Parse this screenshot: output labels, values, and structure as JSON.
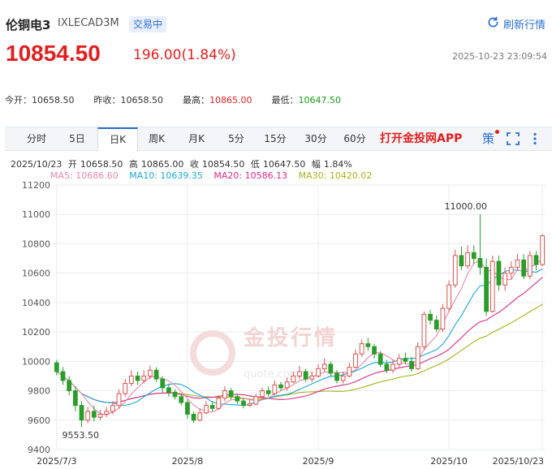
{
  "header": {
    "title": "伦铜电3",
    "code": "IXLECAD3M",
    "status": "交易中",
    "refresh_label": "刷新行情",
    "price": "10854.50",
    "change": "196.00(1.84%)",
    "timestamp": "2025-10-23 23:09:54"
  },
  "stats": [
    {
      "label": "今开：",
      "value": "10658.50",
      "color": "#333333"
    },
    {
      "label": "昨收：",
      "value": "10658.50",
      "color": "#333333"
    },
    {
      "label": "最高：",
      "value": "10865.00",
      "color": "#e02020"
    },
    {
      "label": "最低：",
      "value": "10647.50",
      "color": "#1a9b1a"
    }
  ],
  "toolbar": {
    "tabs": [
      "分时",
      "5日",
      "日K",
      "周K",
      "月K",
      "5分",
      "15分",
      "30分",
      "60分"
    ],
    "active": "日K",
    "promo": "打开金投网APP",
    "strategy_label": "策"
  },
  "ohlc": {
    "date": "2025/10/23",
    "open_label": "开",
    "open": "10658.50",
    "high_label": "高",
    "high": "10865.00",
    "close_label": "收",
    "close": "10854.50",
    "low_label": "低",
    "low": "10647.50",
    "amp_label": "幅",
    "amp": "1.84%"
  },
  "ma_legend": [
    {
      "text": "MA5: 10686.60",
      "color": "#e88aa8"
    },
    {
      "text": "MA10: 10639.35",
      "color": "#1aa7d8"
    },
    {
      "text": "MA20: 10586.13",
      "color": "#d52b8a"
    },
    {
      "text": "MA30: 10420.02",
      "color": "#a3b316"
    }
  ],
  "watermark": {
    "text": "金投行情",
    "sub": "quote.cngold.org"
  },
  "colors": {
    "up": "#d9534f",
    "down": "#2a9d2a",
    "accent": "#2d6fd1"
  },
  "chart_data": {
    "type": "candlestick",
    "yticks": [
      9400,
      9600,
      9800,
      10000,
      10200,
      10400,
      10600,
      10800,
      11000,
      11200
    ],
    "ylim": [
      9400,
      11200
    ],
    "xtick_labels": [
      {
        "label": "2025/7/3",
        "index": 0
      },
      {
        "label": "2025/8",
        "index": 21
      },
      {
        "label": "2025/9",
        "index": 42
      },
      {
        "label": "2025/10",
        "index": 63
      },
      {
        "label": "2025/10/23",
        "index": 78
      }
    ],
    "annotations": [
      {
        "text": "11000.00",
        "index": 68,
        "value": 11000
      },
      {
        "text": "9553.50",
        "index": 4,
        "value": 9553.5
      }
    ],
    "candles": [
      [
        9990,
        9930,
        10010,
        9905
      ],
      [
        9930,
        9870,
        9960,
        9840
      ],
      [
        9870,
        9800,
        9900,
        9770
      ],
      [
        9800,
        9700,
        9830,
        9660
      ],
      [
        9700,
        9600,
        9730,
        9553.5
      ],
      [
        9600,
        9660,
        9690,
        9580
      ],
      [
        9660,
        9620,
        9700,
        9590
      ],
      [
        9620,
        9640,
        9670,
        9600
      ],
      [
        9640,
        9660,
        9690,
        9620
      ],
      [
        9660,
        9700,
        9730,
        9640
      ],
      [
        9700,
        9780,
        9810,
        9680
      ],
      [
        9780,
        9850,
        9880,
        9760
      ],
      [
        9850,
        9900,
        9940,
        9830
      ],
      [
        9900,
        9870,
        9930,
        9840
      ],
      [
        9870,
        9900,
        9940,
        9850
      ],
      [
        9900,
        9940,
        9970,
        9880
      ],
      [
        9940,
        9880,
        9960,
        9860
      ],
      [
        9880,
        9820,
        9900,
        9790
      ],
      [
        9820,
        9790,
        9850,
        9760
      ],
      [
        9790,
        9760,
        9810,
        9740
      ],
      [
        9760,
        9720,
        9780,
        9700
      ],
      [
        9720,
        9640,
        9740,
        9610
      ],
      [
        9640,
        9600,
        9660,
        9580
      ],
      [
        9600,
        9650,
        9680,
        9590
      ],
      [
        9650,
        9700,
        9730,
        9640
      ],
      [
        9700,
        9680,
        9730,
        9660
      ],
      [
        9680,
        9750,
        9770,
        9670
      ],
      [
        9750,
        9800,
        9830,
        9730
      ],
      [
        9800,
        9760,
        9820,
        9740
      ],
      [
        9760,
        9730,
        9780,
        9710
      ],
      [
        9730,
        9700,
        9750,
        9680
      ],
      [
        9700,
        9710,
        9740,
        9690
      ],
      [
        9710,
        9760,
        9780,
        9700
      ],
      [
        9760,
        9800,
        9820,
        9740
      ],
      [
        9800,
        9780,
        9830,
        9760
      ],
      [
        9780,
        9840,
        9870,
        9770
      ],
      [
        9840,
        9820,
        9860,
        9800
      ],
      [
        9820,
        9860,
        9890,
        9800
      ],
      [
        9860,
        9900,
        9930,
        9850
      ],
      [
        9900,
        9930,
        9970,
        9880
      ],
      [
        9930,
        9880,
        9950,
        9860
      ],
      [
        9880,
        9900,
        9930,
        9860
      ],
      [
        9900,
        9950,
        9980,
        9890
      ],
      [
        9950,
        9980,
        10020,
        9930
      ],
      [
        9980,
        9920,
        10000,
        9900
      ],
      [
        9920,
        9870,
        9940,
        9850
      ],
      [
        9870,
        9900,
        9930,
        9850
      ],
      [
        9900,
        9960,
        9990,
        9890
      ],
      [
        9960,
        10050,
        10080,
        9950
      ],
      [
        10050,
        10120,
        10150,
        10030
      ],
      [
        10120,
        10100,
        10160,
        10070
      ],
      [
        10100,
        10050,
        10120,
        10020
      ],
      [
        10050,
        9980,
        10070,
        9960
      ],
      [
        9980,
        9940,
        10010,
        9920
      ],
      [
        9940,
        9980,
        10010,
        9920
      ],
      [
        9980,
        10020,
        10050,
        9960
      ],
      [
        10020,
        10000,
        10060,
        9980
      ],
      [
        10000,
        9950,
        10030,
        9930
      ],
      [
        9950,
        10100,
        10130,
        9940
      ],
      [
        10100,
        10320,
        10340,
        10080
      ],
      [
        10320,
        10280,
        10350,
        10250
      ],
      [
        10280,
        10220,
        10310,
        10200
      ],
      [
        10220,
        10360,
        10390,
        10200
      ],
      [
        10360,
        10520,
        10550,
        10340
      ],
      [
        10520,
        10720,
        10760,
        10500
      ],
      [
        10720,
        10650,
        10780,
        10620
      ],
      [
        10650,
        10740,
        10790,
        10630
      ],
      [
        10740,
        10700,
        10790,
        10660
      ],
      [
        10700,
        10640,
        11000,
        10590
      ],
      [
        10640,
        10340,
        10700,
        10310
      ],
      [
        10340,
        10680,
        10720,
        10330
      ],
      [
        10680,
        10520,
        10720,
        10480
      ],
      [
        10520,
        10600,
        10640,
        10480
      ],
      [
        10600,
        10640,
        10680,
        10560
      ],
      [
        10640,
        10690,
        10730,
        10620
      ],
      [
        10690,
        10580,
        10730,
        10560
      ],
      [
        10580,
        10720,
        10750,
        10560
      ],
      [
        10720,
        10658.5,
        10750,
        10620
      ],
      [
        10658.5,
        10854.5,
        10865,
        10647.5
      ]
    ]
  }
}
